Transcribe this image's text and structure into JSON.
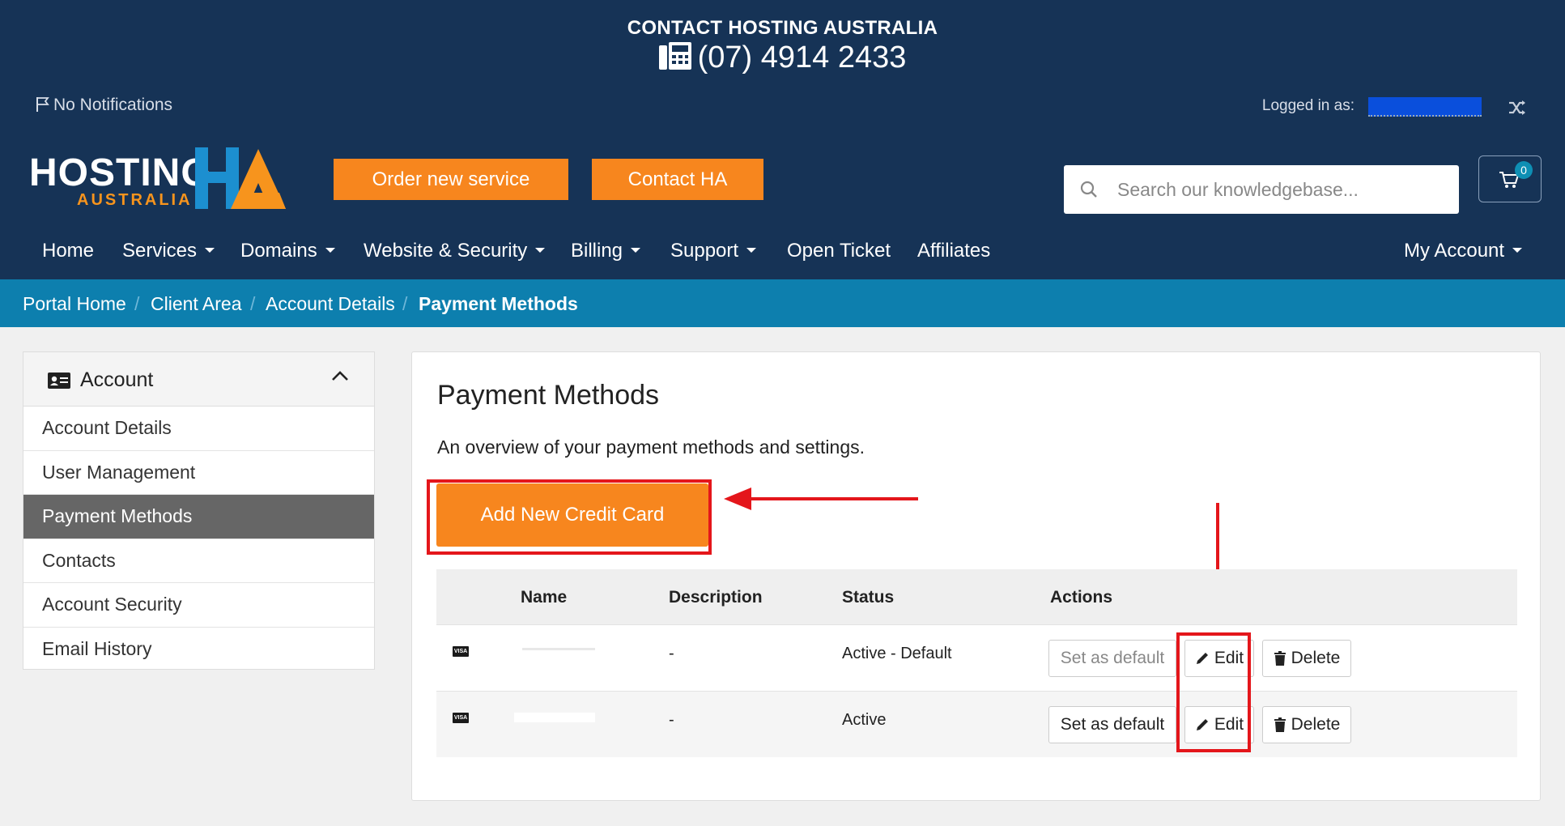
{
  "header": {
    "contact_title": "CONTACT HOSTING AUSTRALIA",
    "phone": "(07) 4914 2433",
    "notifications": "No Notifications",
    "logged_in_label": "Logged in as:",
    "logo_main": "HOSTING",
    "logo_sub": "AUSTRALIA",
    "order_button": "Order new service",
    "contact_button": "Contact HA",
    "search_placeholder": "Search our knowledgebase...",
    "cart_count": "0"
  },
  "nav": {
    "items": [
      {
        "label": "Home",
        "dropdown": false
      },
      {
        "label": "Services",
        "dropdown": true
      },
      {
        "label": "Domains",
        "dropdown": true
      },
      {
        "label": "Website & Security",
        "dropdown": true
      },
      {
        "label": "Billing",
        "dropdown": true
      },
      {
        "label": "Support",
        "dropdown": true
      },
      {
        "label": "Open Ticket",
        "dropdown": false
      },
      {
        "label": "Affiliates",
        "dropdown": false
      }
    ],
    "account": "My Account"
  },
  "breadcrumb": [
    "Portal Home",
    "Client Area",
    "Account Details",
    "Payment Methods"
  ],
  "sidebar": {
    "title": "Account",
    "items": [
      "Account Details",
      "User Management",
      "Payment Methods",
      "Contacts",
      "Account Security",
      "Email History"
    ],
    "active": "Payment Methods"
  },
  "main": {
    "title": "Payment Methods",
    "subtitle": "An overview of your payment methods and settings.",
    "add_button": "Add New Credit Card",
    "table": {
      "headers": [
        "Name",
        "Description",
        "Status",
        "Actions"
      ],
      "rows": [
        {
          "card_type": "VISA",
          "description": "-",
          "status": "Active - Default",
          "set_default": "Set as default",
          "edit": "Edit",
          "delete": "Delete",
          "default_disabled": true
        },
        {
          "card_type": "VISA",
          "description": "-",
          "status": "Active",
          "set_default": "Set as default",
          "edit": "Edit",
          "delete": "Delete",
          "default_disabled": false
        }
      ]
    }
  },
  "colors": {
    "header_bg": "#163356",
    "breadcrumb_bg": "#0d7fae",
    "accent_orange": "#f7861e",
    "annotation_red": "#e4161b"
  }
}
